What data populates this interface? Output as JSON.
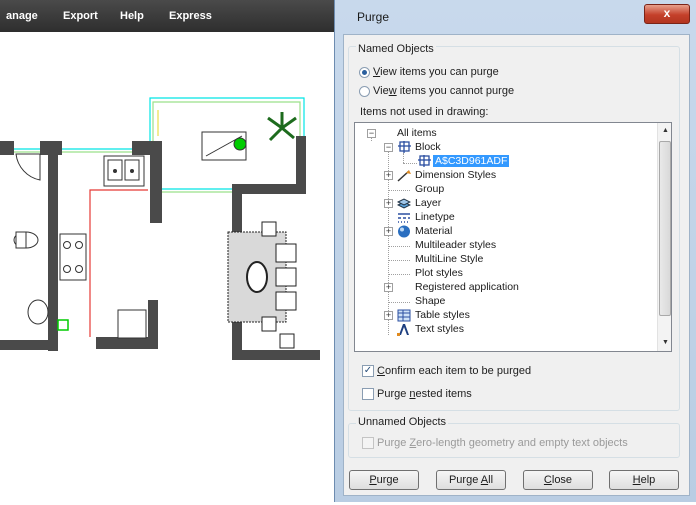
{
  "cad": {
    "menu": [
      "anage",
      "Export",
      "Help",
      "Express"
    ]
  },
  "dialog": {
    "title": "Purge",
    "close_glyph": "x",
    "named_objects_label": "Named Objects",
    "radio_can_purge": {
      "prefix": "",
      "access": "V",
      "rest": "iew items you can purge",
      "selected": true
    },
    "radio_cannot_purge": {
      "prefix": "Vie",
      "access": "w",
      "rest": " items you cannot purge",
      "selected": false
    },
    "tree_caption": "Items not used in drawing:",
    "tree_items": [
      {
        "label": "All items",
        "icon": "none",
        "expander": "minus",
        "level": 0
      },
      {
        "label": "Block",
        "icon": "block-icon",
        "expander": "minus",
        "level": 1
      },
      {
        "label": "A$C3D961ADF",
        "icon": "block-icon",
        "expander": "none",
        "level": 2,
        "selected": true
      },
      {
        "label": "Dimension Styles",
        "icon": "dimension-icon",
        "expander": "plus",
        "level": 1
      },
      {
        "label": "Group",
        "icon": "none",
        "expander": "none",
        "level": 1
      },
      {
        "label": "Layer",
        "icon": "layer-icon",
        "expander": "plus",
        "level": 1
      },
      {
        "label": "Linetype",
        "icon": "linetype-icon",
        "expander": "none",
        "level": 1
      },
      {
        "label": "Material",
        "icon": "material-icon",
        "expander": "plus",
        "level": 1
      },
      {
        "label": "Multileader styles",
        "icon": "none",
        "expander": "none",
        "level": 1
      },
      {
        "label": "MultiLine Style",
        "icon": "none",
        "expander": "none",
        "level": 1
      },
      {
        "label": "Plot styles",
        "icon": "none",
        "expander": "none",
        "level": 1
      },
      {
        "label": "Registered application",
        "icon": "none",
        "expander": "plus",
        "level": 1
      },
      {
        "label": "Shape",
        "icon": "none",
        "expander": "none",
        "level": 1
      },
      {
        "label": "Table styles",
        "icon": "table-icon",
        "expander": "plus",
        "level": 1
      },
      {
        "label": "Text styles",
        "icon": "text-style-icon",
        "expander": "none",
        "level": 1
      }
    ],
    "confirm_checkbox": {
      "access": "C",
      "rest": "onfirm each item to be purged",
      "checked": true
    },
    "nested_checkbox": {
      "prefix": "Purge ",
      "access": "n",
      "rest": "ested items",
      "checked": false
    },
    "unnamed_objects_label": "Unnamed Objects",
    "zero_length_checkbox": {
      "prefix": "Purge ",
      "access": "Z",
      "rest": "ero-length geometry and empty text objects",
      "checked": false,
      "enabled": false
    },
    "buttons": {
      "purge": {
        "access": "P",
        "rest": "urge"
      },
      "purge_all": {
        "prefix": "Purge ",
        "access": "A",
        "rest": "ll"
      },
      "close": {
        "access": "C",
        "rest": "lose"
      },
      "help": {
        "access": "H",
        "rest": "elp"
      }
    }
  },
  "colors": {
    "selection": "#3399ff",
    "wall": "#4a4a4a",
    "accent_cyan": "#00e5e5",
    "accent_green": "#00cc00",
    "accent_red": "#e53935"
  }
}
